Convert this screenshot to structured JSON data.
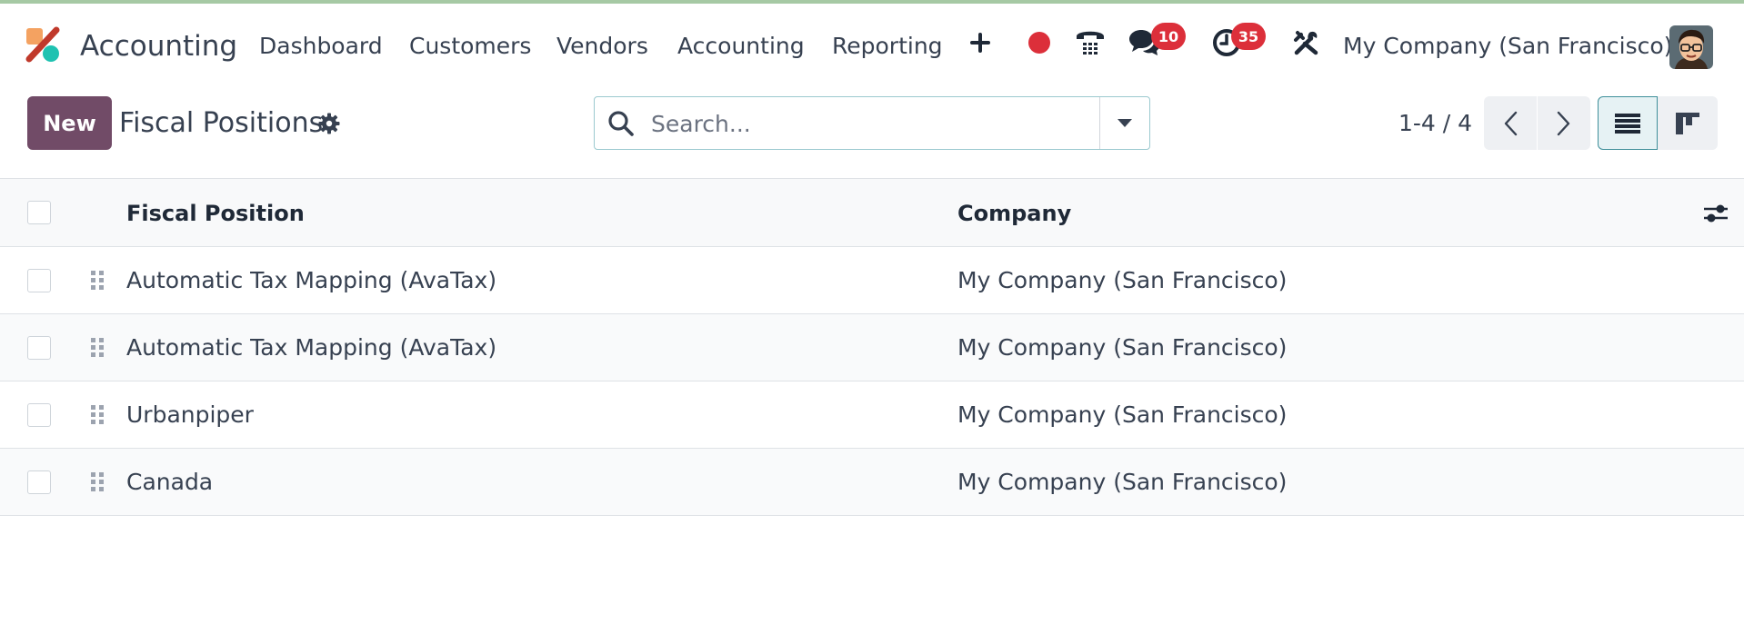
{
  "navbar": {
    "app_name": "Accounting",
    "menu": [
      "Dashboard",
      "Customers",
      "Vendors",
      "Accounting",
      "Reporting"
    ],
    "icons": [
      "plus-icon",
      "record-icon",
      "phone-icon",
      "chat-icon",
      "activity-clock-icon",
      "tools-icon"
    ],
    "messages_count": "10",
    "activities_count": "35",
    "company": "My Company (San Francisco)"
  },
  "control": {
    "new_label": "New",
    "title": "Fiscal Positions",
    "search_placeholder": "Search...",
    "pager": "1-4 / 4"
  },
  "table": {
    "columns": [
      "Fiscal Position",
      "Company"
    ],
    "rows": [
      {
        "name": "Automatic Tax Mapping (AvaTax)",
        "company": "My Company (San Francisco)"
      },
      {
        "name": "Automatic Tax Mapping (AvaTax)",
        "company": "My Company (San Francisco)"
      },
      {
        "name": "Urbanpiper",
        "company": "My Company (San Francisco)"
      },
      {
        "name": "Canada",
        "company": "My Company (San Francisco)"
      }
    ]
  },
  "colors": {
    "primary": "#714b67",
    "badge": "#dc2f3a",
    "active_view": "#e6f2f4"
  }
}
